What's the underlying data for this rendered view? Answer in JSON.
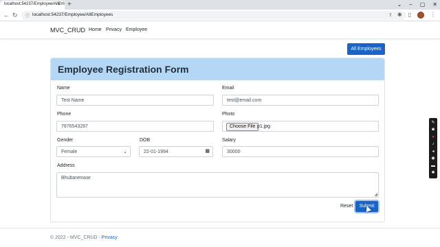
{
  "browser": {
    "tab_title": "localhost:54237/Employee/AllEm",
    "tab_close": "✕",
    "new_tab": "+",
    "url": "localhost:54237/Employee/AllEmployees",
    "window_controls": [
      "⌄",
      "–",
      "▢",
      "✕"
    ]
  },
  "navbar": {
    "brand": "MVC_CRUD",
    "links": [
      "Home",
      "Privacy",
      "Employee"
    ]
  },
  "all_employees_button": "All Employees",
  "form": {
    "title": "Employee Registration Form",
    "name": {
      "label": "Name",
      "value": "Test Name"
    },
    "email": {
      "label": "Email",
      "value": "test@email.com"
    },
    "phone": {
      "label": "Phone",
      "value": "7876543287"
    },
    "photo": {
      "label": "Photo",
      "button": "Choose File",
      "file": "p1.jpg"
    },
    "gender": {
      "label": "Gender",
      "value": "Female"
    },
    "dob": {
      "label": "DOB",
      "value": "22-01-1994"
    },
    "salary": {
      "label": "Salary",
      "value": "30000"
    },
    "address": {
      "label": "Address",
      "value": "Bhubaneswar"
    },
    "reset_label": "Reset",
    "submit_label": "Submit"
  },
  "footer": {
    "text": "© 2022 - MVC_CRUD - ",
    "link": "Privacy"
  },
  "colors": {
    "primary": "#1a63c7",
    "card_header": "#b3d7f5"
  }
}
